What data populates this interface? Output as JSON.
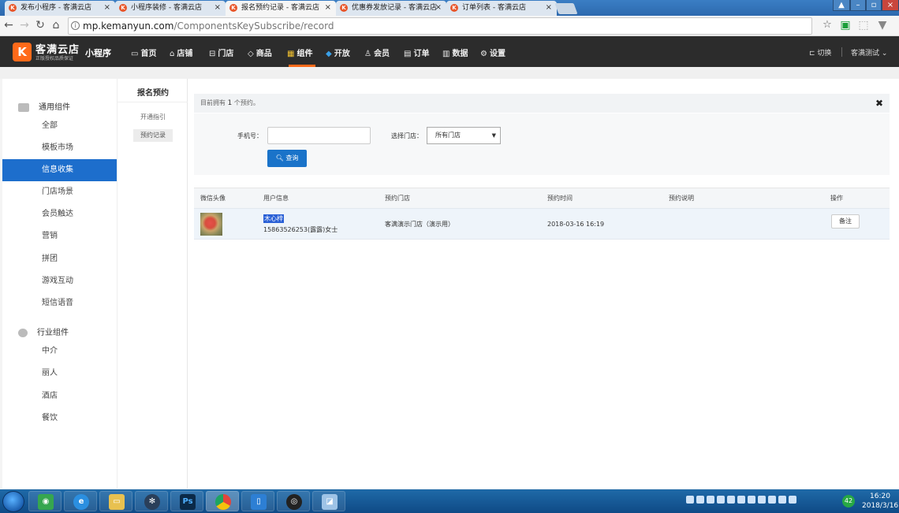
{
  "browser": {
    "tabs": [
      {
        "title": "发布小程序 - 客满云店",
        "active": false
      },
      {
        "title": "小程序装修 - 客满云店",
        "active": false
      },
      {
        "title": "报名预约记录 - 客满云店",
        "active": true
      },
      {
        "title": "优惠券发放记录 - 客满云店",
        "active": false
      },
      {
        "title": "订单列表 - 客满云店",
        "active": false
      }
    ],
    "url_host": "mp.kemanyun.com",
    "url_path": "/ComponentsKeySubscribe/record"
  },
  "appbar": {
    "brand": "客满云店",
    "brand_sub": "正版授权品质保证",
    "product": "小程序",
    "nav": [
      "首页",
      "店铺",
      "门店",
      "商品",
      "组件",
      "开放",
      "会员",
      "订单",
      "数据",
      "设置"
    ],
    "active_nav": "组件",
    "switch_label": "切换",
    "account": "客满测试"
  },
  "sidebar": {
    "groups": [
      {
        "title": "通用组件",
        "items": [
          "全部",
          "模板市场",
          "信息收集",
          "门店场景",
          "会员触达",
          "营销",
          "拼团",
          "游戏互动",
          "短信语音"
        ]
      },
      {
        "title": "行业组件",
        "items": [
          "中介",
          "丽人",
          "酒店",
          "餐饮"
        ]
      }
    ],
    "active_item": "信息收集"
  },
  "subnav": {
    "title": "报名预约",
    "links": [
      "开通指引",
      "预约记录"
    ],
    "active_link": "预约记录"
  },
  "notice": {
    "prefix": "目前拥有",
    "count": "1",
    "suffix": "个预约。"
  },
  "filter": {
    "phone_label": "手机号：",
    "phone_value": "",
    "store_label": "选择门店：",
    "store_selected": "所有门店",
    "query_label": "查询"
  },
  "table": {
    "headers": [
      "微信头像",
      "用户信息",
      "预约门店",
      "预约时间",
      "预约说明",
      "操作"
    ],
    "rows": [
      {
        "nickname": "木心梓",
        "phone_name": "15863526253(露露)女士",
        "store": "客满演示门店（演示用）",
        "time": "2018-03-16 16:19",
        "note": "",
        "action": "备注"
      }
    ]
  },
  "taskbar": {
    "time": "16:20",
    "date": "2018/3/16",
    "badge": "42"
  },
  "colors": {
    "accent": "#ff6a1a",
    "primary": "#1d6ecc",
    "appbar": "#2c2c2c"
  }
}
